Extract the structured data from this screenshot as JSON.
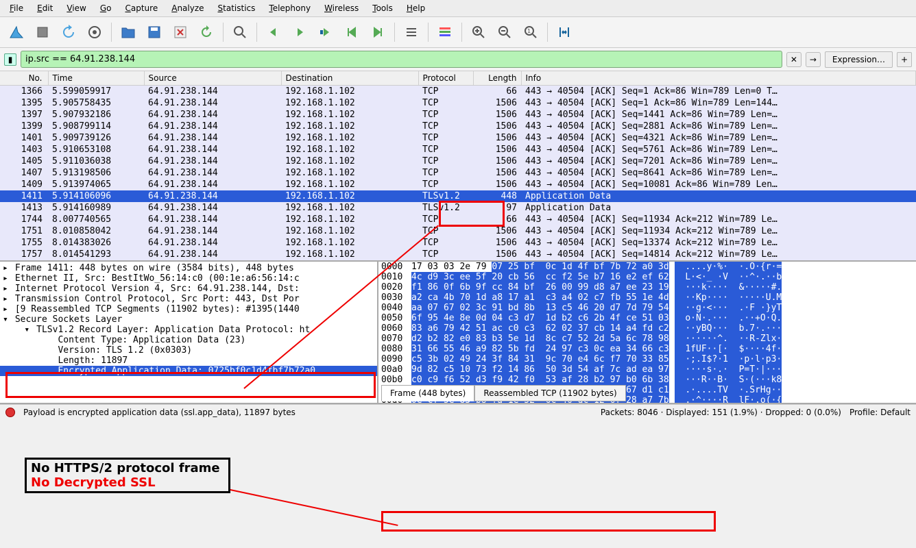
{
  "menu": [
    "File",
    "Edit",
    "View",
    "Go",
    "Capture",
    "Analyze",
    "Statistics",
    "Telephony",
    "Wireless",
    "Tools",
    "Help"
  ],
  "filter": {
    "value": "ip.src == 64.91.238.144",
    "expression_label": "Expression…"
  },
  "columns": [
    "No.",
    "Time",
    "Source",
    "Destination",
    "Protocol",
    "Length",
    "Info"
  ],
  "packets": [
    {
      "no": "1366",
      "time": "5.599059917",
      "src": "64.91.238.144",
      "dst": "192.168.1.102",
      "proto": "TCP",
      "len": "66",
      "info": "443 → 40504 [ACK] Seq=1 Ack=86 Win=789 Len=0 T…"
    },
    {
      "no": "1395",
      "time": "5.905758435",
      "src": "64.91.238.144",
      "dst": "192.168.1.102",
      "proto": "TCP",
      "len": "1506",
      "info": "443 → 40504 [ACK] Seq=1 Ack=86 Win=789 Len=144…"
    },
    {
      "no": "1397",
      "time": "5.907932186",
      "src": "64.91.238.144",
      "dst": "192.168.1.102",
      "proto": "TCP",
      "len": "1506",
      "info": "443 → 40504 [ACK] Seq=1441 Ack=86 Win=789 Len=…"
    },
    {
      "no": "1399",
      "time": "5.908799114",
      "src": "64.91.238.144",
      "dst": "192.168.1.102",
      "proto": "TCP",
      "len": "1506",
      "info": "443 → 40504 [ACK] Seq=2881 Ack=86 Win=789 Len=…"
    },
    {
      "no": "1401",
      "time": "5.909739126",
      "src": "64.91.238.144",
      "dst": "192.168.1.102",
      "proto": "TCP",
      "len": "1506",
      "info": "443 → 40504 [ACK] Seq=4321 Ack=86 Win=789 Len=…"
    },
    {
      "no": "1403",
      "time": "5.910653108",
      "src": "64.91.238.144",
      "dst": "192.168.1.102",
      "proto": "TCP",
      "len": "1506",
      "info": "443 → 40504 [ACK] Seq=5761 Ack=86 Win=789 Len=…"
    },
    {
      "no": "1405",
      "time": "5.911036038",
      "src": "64.91.238.144",
      "dst": "192.168.1.102",
      "proto": "TCP",
      "len": "1506",
      "info": "443 → 40504 [ACK] Seq=7201 Ack=86 Win=789 Len=…"
    },
    {
      "no": "1407",
      "time": "5.913198506",
      "src": "64.91.238.144",
      "dst": "192.168.1.102",
      "proto": "TCP",
      "len": "1506",
      "info": "443 → 40504 [ACK] Seq=8641 Ack=86 Win=789 Len=…"
    },
    {
      "no": "1409",
      "time": "5.913974065",
      "src": "64.91.238.144",
      "dst": "192.168.1.102",
      "proto": "TCP",
      "len": "1506",
      "info": "443 → 40504 [ACK] Seq=10081 Ack=86 Win=789 Len…"
    },
    {
      "no": "1411",
      "time": "5.914106096",
      "src": "64.91.238.144",
      "dst": "192.168.1.102",
      "proto": "TLSv1.2",
      "len": "448",
      "info": "Application Data",
      "sel": true
    },
    {
      "no": "1413",
      "time": "5.914160989",
      "src": "64.91.238.144",
      "dst": "192.168.1.102",
      "proto": "TLSv1.2",
      "len": "97",
      "info": "Application Data"
    },
    {
      "no": "1744",
      "time": "8.007740565",
      "src": "64.91.238.144",
      "dst": "192.168.1.102",
      "proto": "TCP",
      "len": "66",
      "info": "443 → 40504 [ACK] Seq=11934 Ack=212 Win=789 Le…"
    },
    {
      "no": "1751",
      "time": "8.010858042",
      "src": "64.91.238.144",
      "dst": "192.168.1.102",
      "proto": "TCP",
      "len": "1506",
      "info": "443 → 40504 [ACK] Seq=11934 Ack=212 Win=789 Le…"
    },
    {
      "no": "1755",
      "time": "8.014383026",
      "src": "64.91.238.144",
      "dst": "192.168.1.102",
      "proto": "TCP",
      "len": "1506",
      "info": "443 → 40504 [ACK] Seq=13374 Ack=212 Win=789 Le…"
    },
    {
      "no": "1757",
      "time": "8.014541293",
      "src": "64.91.238.144",
      "dst": "192.168.1.102",
      "proto": "TCP",
      "len": "1506",
      "info": "443 → 40504 [ACK] Seq=14814 Ack=212 Win=789 Le…"
    }
  ],
  "detail_tree": [
    {
      "indent": 0,
      "arrow": "right",
      "text": "Frame 1411: 448 bytes on wire (3584 bits), 448 bytes"
    },
    {
      "indent": 0,
      "arrow": "right",
      "text": "Ethernet II, Src: BestItWo_56:14:c0 (00:1e:a6:56:14:c"
    },
    {
      "indent": 0,
      "arrow": "right",
      "text": "Internet Protocol Version 4, Src: 64.91.238.144, Dst:"
    },
    {
      "indent": 0,
      "arrow": "right",
      "text": "Transmission Control Protocol, Src Port: 443, Dst Por"
    },
    {
      "indent": 0,
      "arrow": "right",
      "text": "[9 Reassembled TCP Segments (11902 bytes): #1395(1440"
    },
    {
      "indent": 0,
      "arrow": "down",
      "text": "Secure Sockets Layer"
    },
    {
      "indent": 1,
      "arrow": "down",
      "text": "TLSv1.2 Record Layer: Application Data Protocol: ht"
    },
    {
      "indent": 2,
      "arrow": "",
      "text": "Content Type: Application Data (23)"
    },
    {
      "indent": 2,
      "arrow": "",
      "text": "Version: TLS 1.2 (0x0303)"
    },
    {
      "indent": 2,
      "arrow": "",
      "text": "Length: 11897"
    },
    {
      "indent": 2,
      "arrow": "",
      "text": "Encrypted Application Data: 0725bf0c1d4fbf7b72a0",
      "sel": true
    }
  ],
  "hex_rows": [
    {
      "off": "0000",
      "bytes": "17 03 03 2e 79 ",
      "bytes_sel": "07 25 bf  0c 1d 4f bf 7b 72 a0 3d",
      "ascii": "....y·%·  ·.O·{r·=",
      "sel_from": 5
    },
    {
      "off": "0010",
      "bytes": "",
      "bytes_sel": "4c d9 3c ee 5f 20 cb 56  cc f2 5e b7 16 e2 ef 62",
      "ascii": "L·<·_ ·V  ··^·.··b"
    },
    {
      "off": "0020",
      "bytes": "",
      "bytes_sel": "f1 86 0f 6b 9f cc 84 bf  26 00 99 d8 a7 ee 23 19",
      "ascii": "···k····  &·····#."
    },
    {
      "off": "0030",
      "bytes": "",
      "bytes_sel": "a2 ca 4b 70 1d a8 17 a1  c3 a4 02 c7 fb 55 1e 4d",
      "ascii": "··Kp····  ·····U.M"
    },
    {
      "off": "0040",
      "bytes": "",
      "bytes_sel": "aa 07 67 02 3c 91 bd 8b  13 c5 46 20 d7 7d 79 54",
      "ascii": "··g·<···  .·F ·}yT"
    },
    {
      "off": "0050",
      "bytes": "",
      "bytes_sel": "6f 95 4e 8e 0d 04 c3 d7  1d b2 c6 2b 4f ce 51 03",
      "ascii": "o·N·.···  .··+O·Q."
    },
    {
      "off": "0060",
      "bytes": "",
      "bytes_sel": "83 a6 79 42 51 ac c0 c3  62 02 37 cb 14 a4 fd c2",
      "ascii": "··yBQ···  b.7·.···"
    },
    {
      "off": "0070",
      "bytes": "",
      "bytes_sel": "d2 b2 82 e0 83 b3 5e 1d  8c c7 52 2d 5a 6c 78 98",
      "ascii": "······^.  ··R-Zlx·"
    },
    {
      "off": "0080",
      "bytes": "",
      "bytes_sel": "31 66 55 46 a9 82 5b fd  24 97 c3 0c ea 34 66 c3",
      "ascii": "1fUF··[·  $····4f·"
    },
    {
      "off": "0090",
      "bytes": "",
      "bytes_sel": "c5 3b 02 49 24 3f 84 31  9c 70 e4 6c f7 70 33 85",
      "ascii": "·;.I$?·1  ·p·l·p3·"
    },
    {
      "off": "00a0",
      "bytes": "",
      "bytes_sel": "9d 82 c5 10 73 f2 14 86  50 3d 54 af 7c ad ea 97",
      "ascii": "····s·.·  P=T·|···"
    },
    {
      "off": "00b0",
      "bytes": "",
      "bytes_sel": "c0 c9 f6 52 d3 f9 42 f0  53 af 28 b2 97 b0 6b 38",
      "ascii": "···R··B·  S·(···k8"
    },
    {
      "off": "00c0",
      "bytes": "",
      "bytes_sel": "09 c9 02 18 a1 04 54 56  e8 5c 53 72 48 67 d1 c1",
      "ascii": ".·....TV  ·.SrHg··"
    },
    {
      "off": "00d0",
      "bytes": "",
      "bytes_sel": "0e cf 5e 83 b8 fa 1e 52  6c 46 dc 12 6f 28 a7 7b",
      "ascii": ".·^····R  lF·.o(·{"
    }
  ],
  "hex_tabs": {
    "frame": "Frame (448 bytes)",
    "reassembled": "Reassembled TCP (11902 bytes)"
  },
  "status": {
    "hint": "Payload is encrypted application data (ssl.app_data), 11897 bytes",
    "packets": "Packets: 8046 · Displayed: 151 (1.9%) · Dropped: 0 (0.0%)",
    "profile": "Profile: Default"
  },
  "annotations": {
    "label1": "No HTTPS/2 protocol frame",
    "label2": "No Decrypted SSL"
  }
}
